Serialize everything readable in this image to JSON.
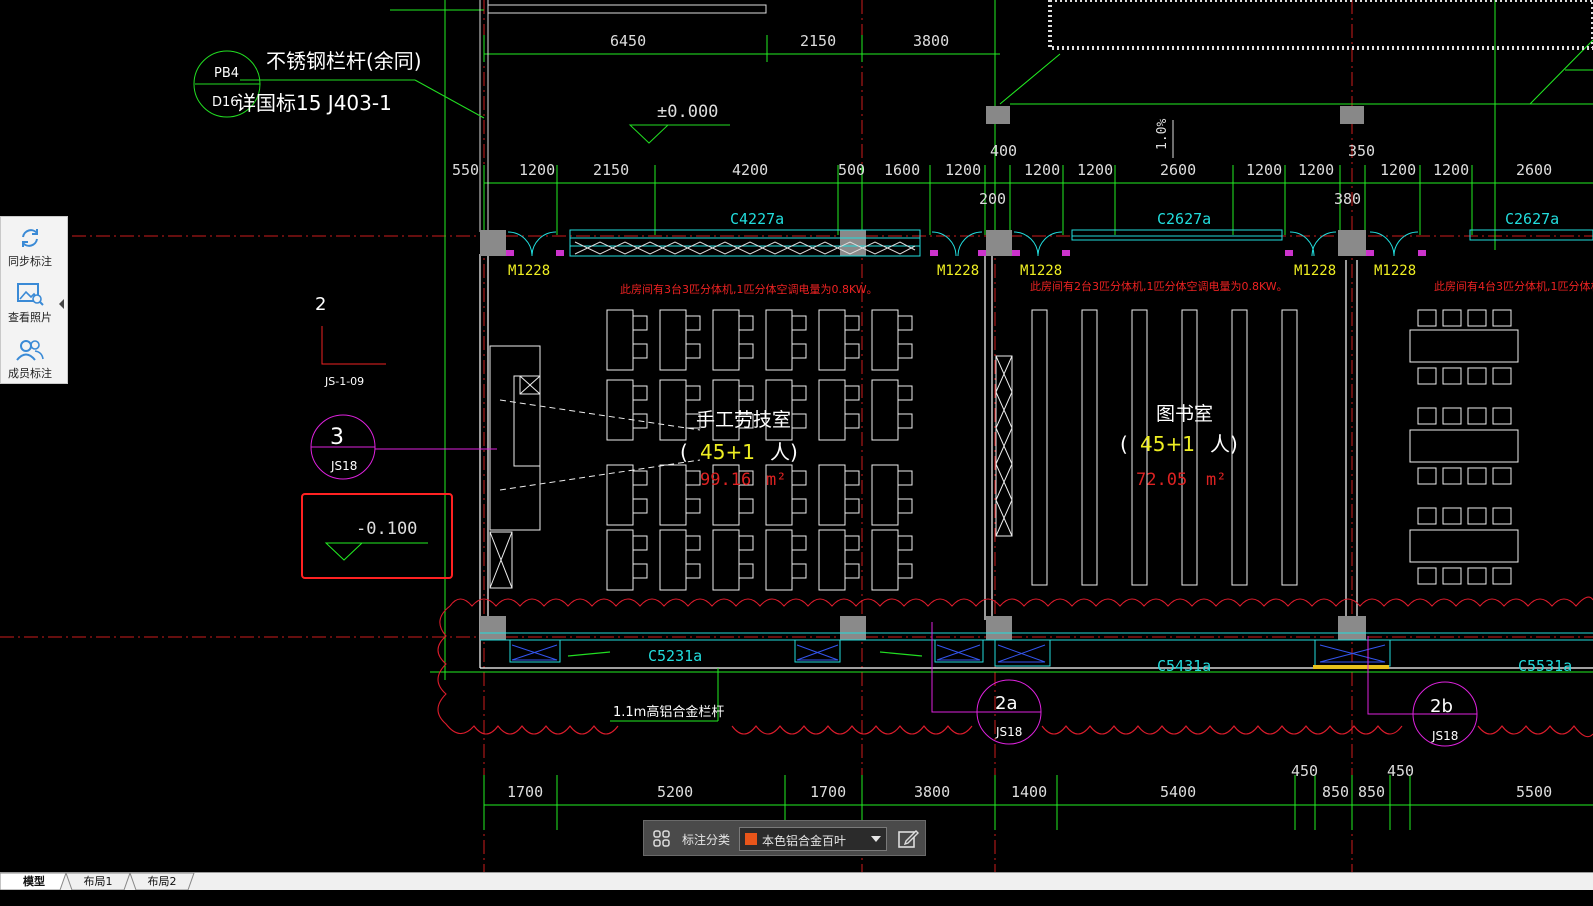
{
  "toolbar": {
    "items": [
      {
        "label": "同步标注",
        "icon": "sync-icon"
      },
      {
        "label": "查看照片",
        "icon": "photo-search-icon"
      },
      {
        "label": "成员标注",
        "icon": "members-icon"
      }
    ]
  },
  "drawing": {
    "top_dims": [
      "6450",
      "2150",
      "3800"
    ],
    "upper_dims": [
      "550",
      "1200",
      "2150",
      "4200",
      "500",
      "1600",
      "1200",
      "400",
      "1200",
      "1200",
      "2600",
      "1200",
      "1200",
      "350",
      "1200",
      "1200",
      "2600"
    ],
    "sub_dims": [
      "200",
      "380"
    ],
    "slope": "1.0%",
    "lower_dims": [
      "1700",
      "5200",
      "1700",
      "3800",
      "1400",
      "5400",
      "850",
      "850",
      "5500"
    ],
    "lower_sub_dims": [
      "450",
      "450"
    ],
    "railing_note": "不锈钢栏杆(余同)",
    "railing_ref": "详国标15 J403-1",
    "railing_circle_top": "PB4",
    "railing_circle_bottom": "D16",
    "elevation_top": "±0.000",
    "elevation_left": "-0.100",
    "section_number": "2",
    "section_ref": "JS-1-09",
    "detail3_num": "3",
    "detail3_ref": "JS18",
    "detail2a_num": "2a",
    "detail2a_ref": "JS18",
    "detail2b_num": "2b",
    "detail2b_ref": "JS18",
    "windows": {
      "w1": "C4227a",
      "w2": "C2627a",
      "w3": "C2627a",
      "w4": "C5231a",
      "w5": "C5431a",
      "w6": "C5531a"
    },
    "doors": {
      "d1": "M1228",
      "d2": "M1228",
      "d3": "M1228",
      "d4": "M1228",
      "d5": "M1228"
    },
    "room1": {
      "name": "手工劳技室",
      "occupancy": "45+1",
      "open": "(",
      "close": "人)",
      "area": "99.16",
      "unit": "m²",
      "note": "此房间有3台3匹分体机,1匹分体空调电量为0.8KW。"
    },
    "room2": {
      "name": "图书室",
      "occupancy": "45+1",
      "open": "(",
      "close": "人)",
      "area": "72.05",
      "unit": "m²",
      "note": "此房间有2台3匹分体机,1匹分体空调电量为0.8KW。"
    },
    "room3_note": "此房间有4台3匹分体机,1匹分体机",
    "railing_low": "1.1m高铝合金栏杆"
  },
  "annotation_bar": {
    "label": "标注分类",
    "selected": "本色铝合金百叶",
    "swatch_color": "#e8551a"
  },
  "tabs": [
    {
      "label": "模型",
      "active": true
    },
    {
      "label": "布局1",
      "active": false
    },
    {
      "label": "布局2",
      "active": false
    }
  ],
  "colors": {
    "dimension": "#22ee22",
    "wall": "#ffffff",
    "window": "#22dddd",
    "door_label": "#eeee22",
    "room_note": "#ee2222",
    "axis": "#ee2222",
    "column": "#999999",
    "highlight": "#ff2222"
  }
}
